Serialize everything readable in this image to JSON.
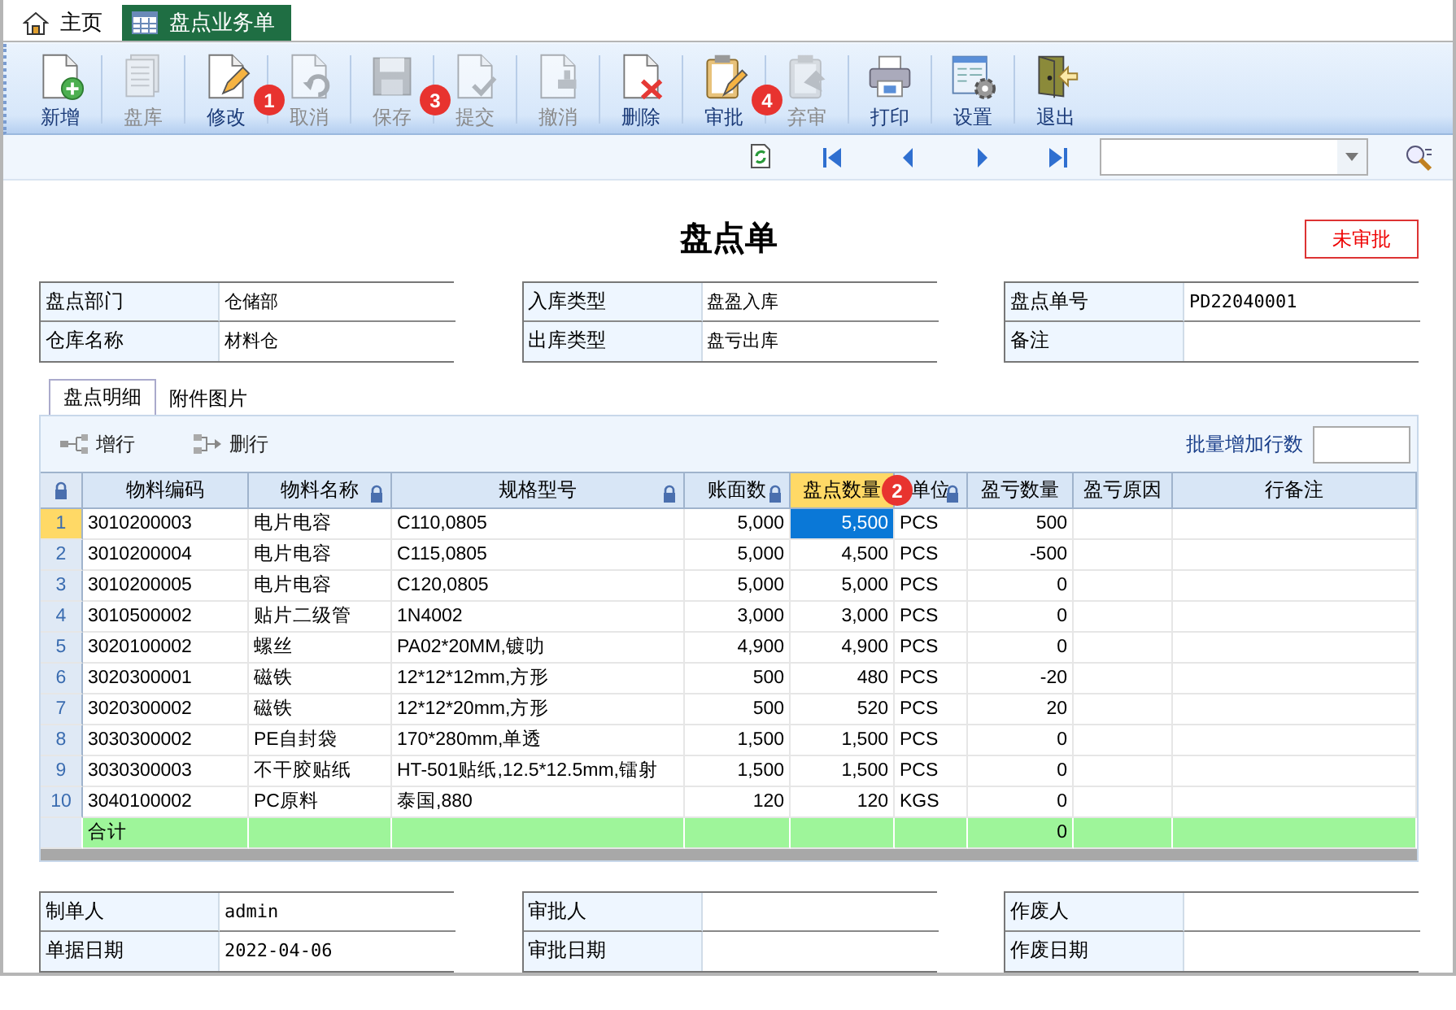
{
  "tabs": [
    {
      "label": "主页",
      "selected": false
    },
    {
      "label": "盘点业务单",
      "selected": true
    }
  ],
  "toolbar": [
    {
      "label": "新增",
      "kind": "new",
      "disabled": false
    },
    {
      "label": "盘库",
      "kind": "stock",
      "disabled": true
    },
    {
      "label": "修改",
      "kind": "edit",
      "disabled": false,
      "badge": "1"
    },
    {
      "label": "取消",
      "kind": "cancel",
      "disabled": true
    },
    {
      "label": "保存",
      "kind": "save",
      "disabled": true,
      "badge": "3"
    },
    {
      "label": "提交",
      "kind": "submit",
      "disabled": true
    },
    {
      "label": "撤消",
      "kind": "revoke",
      "disabled": true
    },
    {
      "label": "删除",
      "kind": "delete",
      "disabled": false
    },
    {
      "label": "审批",
      "kind": "approve",
      "disabled": false,
      "badge": "4"
    },
    {
      "label": "弃审",
      "kind": "unapprove",
      "disabled": true
    },
    {
      "label": "打印",
      "kind": "print",
      "disabled": false
    },
    {
      "label": "设置",
      "kind": "settings",
      "disabled": false
    },
    {
      "label": "退出",
      "kind": "exit",
      "disabled": false
    }
  ],
  "document": {
    "title": "盘点单",
    "status": "未审批"
  },
  "header_forms": [
    {
      "fields": [
        {
          "label": "盘点部门",
          "value": "仓储部"
        },
        {
          "label": "仓库名称",
          "value": "材料仓"
        }
      ]
    },
    {
      "fields": [
        {
          "label": "入库类型",
          "value": "盘盈入库"
        },
        {
          "label": "出库类型",
          "value": "盘亏出库"
        }
      ]
    },
    {
      "fields": [
        {
          "label": "盘点单号",
          "value": "PD22040001"
        },
        {
          "label": "备注"
        }
      ]
    }
  ],
  "detail_tabs": [
    {
      "label": "盘点明细",
      "selected": true
    },
    {
      "label": "附件图片",
      "selected": false
    }
  ],
  "grid": {
    "actions": [
      {
        "label": "增行",
        "kind": "add"
      },
      {
        "label": "删行",
        "kind": "remove"
      }
    ],
    "batch_label": "批量增加行数",
    "row_header": {
      "locked": true
    },
    "columns": [
      {
        "label": "物料编码",
        "kind": "text",
        "locked": false,
        "selected": false
      },
      {
        "label": "物料名称",
        "kind": "text",
        "locked": true,
        "selected": false
      },
      {
        "label": "规格型号",
        "kind": "text",
        "locked": true,
        "selected": false
      },
      {
        "label": "账面数",
        "kind": "number",
        "locked": true,
        "selected": false
      },
      {
        "label": "盘点数量",
        "kind": "number",
        "locked": false,
        "selected": true,
        "badge": "2"
      },
      {
        "label": "单位",
        "kind": "text",
        "locked": true,
        "selected": false
      },
      {
        "label": "盈亏数量",
        "kind": "number",
        "locked": false,
        "selected": false
      },
      {
        "label": "盈亏原因",
        "kind": "text",
        "locked": false,
        "selected": false
      },
      {
        "label": "行备注",
        "kind": "text",
        "locked": false,
        "selected": false
      }
    ],
    "rows": [
      {
        "number": "1",
        "selected": true,
        "cells": [
          "3010200003",
          "电片电容",
          "C110,0805",
          "5,000",
          "5,500",
          "PCS",
          "500"
        ]
      },
      {
        "number": "2",
        "selected": false,
        "cells": [
          "3010200004",
          "电片电容",
          "C115,0805",
          "5,000",
          "4,500",
          "PCS",
          "-500"
        ]
      },
      {
        "number": "3",
        "selected": false,
        "cells": [
          "3010200005",
          "电片电容",
          "C120,0805",
          "5,000",
          "5,000",
          "PCS",
          "0"
        ]
      },
      {
        "number": "4",
        "selected": false,
        "cells": [
          "3010500002",
          "贴片二级管",
          "1N4002",
          "3,000",
          "3,000",
          "PCS",
          "0"
        ]
      },
      {
        "number": "5",
        "selected": false,
        "cells": [
          "3020100002",
          "螺丝",
          "PA02*20MM,镀叻",
          "4,900",
          "4,900",
          "PCS",
          "0"
        ]
      },
      {
        "number": "6",
        "selected": false,
        "cells": [
          "3020300001",
          "磁铁",
          "12*12*12mm,方形",
          "500",
          "480",
          "PCS",
          "-20"
        ]
      },
      {
        "number": "7",
        "selected": false,
        "cells": [
          "3020300002",
          "磁铁",
          "12*12*20mm,方形",
          "500",
          "520",
          "PCS",
          "20"
        ]
      },
      {
        "number": "8",
        "selected": false,
        "cells": [
          "3030300002",
          "PE自封袋",
          "170*280mm,单透",
          "1,500",
          "1,500",
          "PCS",
          "0"
        ]
      },
      {
        "number": "9",
        "selected": false,
        "cells": [
          "3030300003",
          "不干胶贴纸",
          "HT-501贴纸,12.5*12.5mm,镭射",
          "1,500",
          "1,500",
          "PCS",
          "0"
        ]
      },
      {
        "number": "10",
        "selected": false,
        "cells": [
          "3040100002",
          "PC原料",
          "泰国,880",
          "120",
          "120",
          "KGS",
          "0"
        ]
      }
    ],
    "total_row": {
      "cells": [
        "合计",
        null,
        null,
        null,
        null,
        null,
        "0",
        null,
        null
      ]
    }
  },
  "footer_forms": [
    {
      "fields": [
        {
          "label": "制单人",
          "value": "admin"
        },
        {
          "label": "单据日期",
          "value": "2022-04-06"
        }
      ]
    },
    {
      "fields": [
        {
          "label": "审批人"
        },
        {
          "label": "审批日期"
        }
      ]
    },
    {
      "fields": [
        {
          "label": "作废人"
        },
        {
          "label": "作废日期"
        }
      ]
    }
  ]
}
